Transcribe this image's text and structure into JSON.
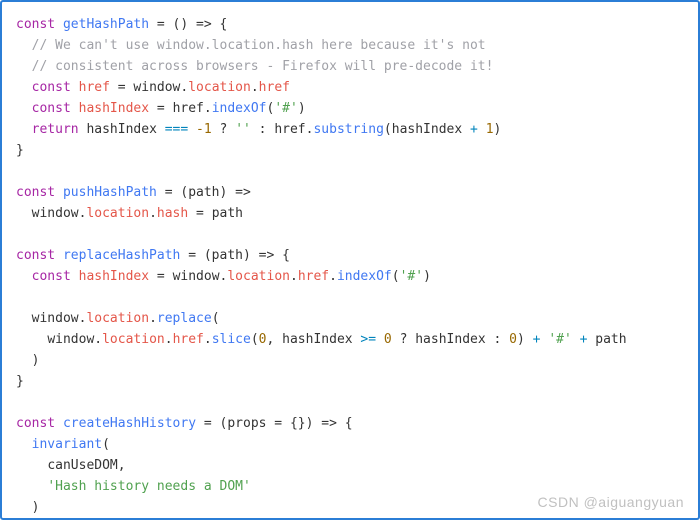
{
  "watermark": "CSDN @aiguangyuan",
  "code": {
    "l01": {
      "kw_const": "const",
      "name": "getHashPath",
      "arrow": " = () => {"
    },
    "l02": {
      "cmt": "// We can't use window.location.hash here because it's not"
    },
    "l03": {
      "cmt": "// consistent across browsers - Firefox will pre-decode it!"
    },
    "l04": {
      "kw_const": "const",
      "name": "href",
      "eq": " = ",
      "obj1": "window",
      "dot1": ".",
      "prop1": "location",
      "dot2": ".",
      "prop2": "href"
    },
    "l05": {
      "kw_const": "const",
      "name": "hashIndex",
      "eq": " = ",
      "obj": "href",
      "dot": ".",
      "fn": "indexOf",
      "open": "(",
      "str": "'#'",
      "close": ")"
    },
    "l06": {
      "kw_return": "return",
      "id1": "hashIndex",
      "op1": " === ",
      "num1": "-1",
      "q": " ? ",
      "str1": "''",
      "colon": " : ",
      "obj": "href",
      "dot": ".",
      "fn": "substring",
      "open": "(",
      "id2": "hashIndex",
      "op2": " + ",
      "num2": "1",
      "close": ")"
    },
    "l07": {
      "brace": "}"
    },
    "l09": {
      "kw_const": "const",
      "name": "pushHashPath",
      "arrow": " = (path) =>"
    },
    "l10": {
      "obj1": "window",
      "dot1": ".",
      "prop1": "location",
      "dot2": ".",
      "prop2": "hash",
      "eq": " = ",
      "id": "path"
    },
    "l12": {
      "kw_const": "const",
      "name": "replaceHashPath",
      "arrow": " = (path) => {"
    },
    "l13": {
      "kw_const": "const",
      "name": "hashIndex",
      "eq": " = ",
      "obj1": "window",
      "dot1": ".",
      "prop1": "location",
      "dot2": ".",
      "prop2": "href",
      "dot3": ".",
      "fn": "indexOf",
      "open": "(",
      "str": "'#'",
      "close": ")"
    },
    "l15": {
      "obj1": "window",
      "dot1": ".",
      "prop1": "location",
      "dot2": ".",
      "fn": "replace",
      "open": "("
    },
    "l16": {
      "obj1": "window",
      "dot1": ".",
      "prop1": "location",
      "dot2": ".",
      "prop2": "href",
      "dot3": ".",
      "fn": "slice",
      "open": "(",
      "num0": "0",
      "comma": ", ",
      "id1": "hashIndex",
      "op1": " >= ",
      "num1": "0",
      "q": " ? ",
      "id2": "hashIndex",
      "colon": " : ",
      "num2": "0",
      "close1": ")",
      "op2": " + ",
      "str1": "'#'",
      "op3": " + ",
      "id3": "path"
    },
    "l17": {
      "close": ")"
    },
    "l18": {
      "brace": "}"
    },
    "l20": {
      "kw_const": "const",
      "name": "createHashHistory",
      "arrow": " = (props = {}) => {"
    },
    "l21": {
      "fn": "invariant",
      "open": "("
    },
    "l22": {
      "id": "canUseDOM",
      "comma": ","
    },
    "l23": {
      "str": "'Hash history needs a DOM'"
    },
    "l24": {
      "close": ")"
    }
  }
}
